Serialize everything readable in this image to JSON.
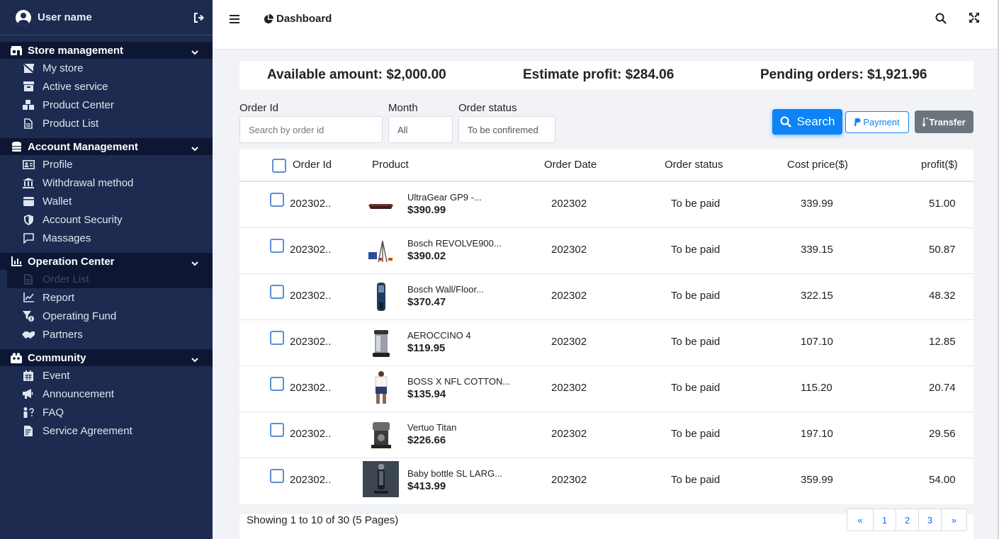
{
  "sidebar": {
    "user_name": "User name",
    "groups": [
      {
        "label": "Store management",
        "items": [
          "My store",
          "Active service",
          "Product Center",
          "Product List"
        ]
      },
      {
        "label": "Account Management",
        "items": [
          "Profile",
          "Withdrawal method",
          "Wallet",
          "Account Security",
          "Massages"
        ]
      },
      {
        "label": "Operation Center",
        "items": [
          "Order List",
          "Report",
          "Operating Fund",
          "Partners"
        ]
      },
      {
        "label": "Community",
        "items": [
          "Event",
          "Announcement",
          "FAQ",
          "Service Agreement"
        ]
      }
    ],
    "active_item": "Order List"
  },
  "header": {
    "title": "Dashboard"
  },
  "stats": {
    "available": "Available amount: $2,000.00",
    "profit": "Estimate profit: $284.06",
    "pending": "Pending orders: $1,921.96"
  },
  "filters": {
    "order_id_label": "Order Id",
    "order_id_placeholder": "Search by order id",
    "month_label": "Month",
    "month_value": "All",
    "status_label": "Order status",
    "status_value": "To be confiremed",
    "search_label": "Search",
    "payment_label": "Payment",
    "transfer_label": "Transfer"
  },
  "table": {
    "headers": [
      "Order Id",
      "Product",
      "Order Date",
      "Order status",
      "Cost price($)",
      "profit($)"
    ],
    "rows": [
      {
        "id": "202302..",
        "name": "UltraGear GP9 -...",
        "price": "$390.99",
        "date": "202302",
        "status": "To be paid",
        "cost": "339.99",
        "profit": "51.00"
      },
      {
        "id": "202302..",
        "name": "Bosch REVOLVE900...",
        "price": "$390.02",
        "date": "202302",
        "status": "To be paid",
        "cost": "339.15",
        "profit": "50.87"
      },
      {
        "id": "202302..",
        "name": "Bosch Wall/Floor...",
        "price": "$370.47",
        "date": "202302",
        "status": "To be paid",
        "cost": "322.15",
        "profit": "48.32"
      },
      {
        "id": "202302..",
        "name": "AEROCCINO 4",
        "price": "$119.95",
        "date": "202302",
        "status": "To be paid",
        "cost": "107.10",
        "profit": "12.85"
      },
      {
        "id": "202302..",
        "name": "BOSS X NFL COTTON...",
        "price": "$135.94",
        "date": "202302",
        "status": "To be paid",
        "cost": "115.20",
        "profit": "20.74"
      },
      {
        "id": "202302..",
        "name": "Vertuo Titan",
        "price": "$226.66",
        "date": "202302",
        "status": "To be paid",
        "cost": "197.10",
        "profit": "29.56"
      },
      {
        "id": "202302..",
        "name": "Baby bottle SL LARG...",
        "price": "$413.99",
        "date": "202302",
        "status": "To be paid",
        "cost": "359.99",
        "profit": "54.00"
      }
    ]
  },
  "footer": {
    "showing": "Showing 1 to 10 of 30 (5 Pages)",
    "pages": [
      "«",
      "1",
      "2",
      "3",
      "»"
    ]
  }
}
